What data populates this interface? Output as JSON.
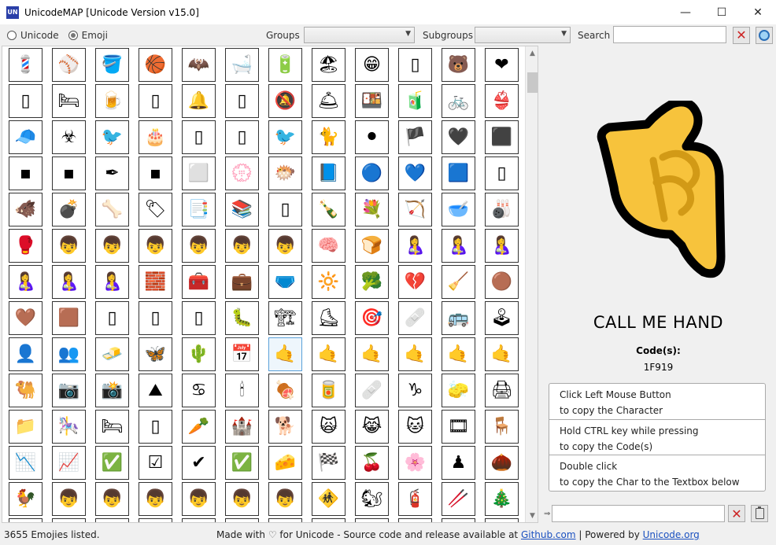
{
  "window": {
    "title": "UnicodeMAP [Unicode Version v15.0]",
    "app_icon": "UN",
    "minimize": "—",
    "maximize": "☐",
    "close": "✕"
  },
  "toolbar": {
    "unicode_label": "Unicode",
    "emoji_label": "Emoji",
    "mode_selected": "Emoji",
    "groups_label": "Groups",
    "groups_value": "",
    "subgroups_label": "Subgroups",
    "subgroups_value": "",
    "search_label": "Search",
    "search_value": "",
    "clear_glyph": "✕"
  },
  "emoji_rows": [
    [
      "💈",
      "⚾",
      "🪣",
      "🏀",
      "🦇",
      "🛁",
      "🔋",
      "🏖",
      "😁",
      "▯",
      "🐻",
      "❤"
    ],
    [
      "▯",
      "🛏",
      "🍺",
      "▯",
      "🔔",
      "▯",
      "🔕",
      "🛎",
      "🍱",
      "🧃",
      "🚲",
      "👙"
    ],
    [
      "🧢",
      "☣",
      "🐦",
      "🎂",
      "▯",
      "▯",
      "🐦",
      "🐈",
      "⚫",
      "🏴",
      "🖤",
      "⬛"
    ],
    [
      "▪",
      "▪",
      "✒",
      "▪",
      "⬜",
      "💮",
      "🐡",
      "📘",
      "🔵",
      "💙",
      "🟦",
      "▯"
    ],
    [
      "🐗",
      "💣",
      "🦴",
      "🏷",
      "📑",
      "📚",
      "▯",
      "🍾",
      "💐",
      "🏹",
      "🥣",
      "🎳"
    ],
    [
      "🥊",
      "👦",
      "👦",
      "👦",
      "👦",
      "👦",
      "👦",
      "🧠",
      "🍞",
      "🤱",
      "🤱",
      "🤱"
    ],
    [
      "🤱",
      "🤱",
      "🤱",
      "🧱",
      "🧰",
      "💼",
      "🩲",
      "🔆",
      "🥦",
      "💔",
      "🧹",
      "🟤"
    ],
    [
      "🤎",
      "🟫",
      "▯",
      "▯",
      "▯",
      "🐛",
      "🏗",
      "⛸",
      "🎯",
      "🩹",
      "🚌",
      "🕹"
    ],
    [
      "👤",
      "👥",
      "🧈",
      "🦋",
      "🌵",
      "📅",
      "🤙",
      "🤙",
      "🤙",
      "🤙",
      "🤙",
      "🤙"
    ],
    [
      "🐫",
      "📷",
      "📸",
      "⛰",
      "♋",
      "🕯",
      "🍖",
      "🥫",
      "🩹",
      "♑",
      "🧽",
      "🖨"
    ],
    [
      "📁",
      "🎠",
      "🛏",
      "▯",
      "🥕",
      "🏰",
      "🐕",
      "🙀",
      "😹",
      "🐱",
      "🎞",
      "🪑"
    ],
    [
      "📉",
      "📈",
      "✅",
      "☑",
      "✔",
      "✅",
      "🧀",
      "🏁",
      "🍒",
      "🌸",
      "♟",
      "🌰"
    ],
    [
      "🐓",
      "👦",
      "👦",
      "👦",
      "👦",
      "👦",
      "👦",
      "🚸",
      "🐿",
      "🧯",
      "🥢",
      "🎄"
    ],
    [
      "▯",
      "▯",
      "▯",
      "▯",
      "▯",
      "▯",
      "▯",
      "▯",
      "▯",
      "▯",
      "▯",
      "▯"
    ]
  ],
  "selected_cell": {
    "row": 8,
    "col": 6
  },
  "detail": {
    "emoji": "🤙",
    "name": "CALL ME HAND",
    "codes_label": "Code(s):",
    "codes_value": "1F919",
    "emoji_colors": {
      "fill": "#f7c33c",
      "outline": "#000000",
      "shade": "#d29a16"
    }
  },
  "help": [
    {
      "line1": "Click Left Mouse Button",
      "line2": "to copy the Character"
    },
    {
      "line1": "Hold CTRL key while pressing",
      "line2": "to copy the Code(s)"
    },
    {
      "line1": "Double click",
      "line2": "to copy the Char to the Textbox below"
    }
  ],
  "copy_box": {
    "value": "",
    "arrow": "⇒",
    "clear_glyph": "✕"
  },
  "status": {
    "count": "3655 Emojies listed.",
    "made_with": "Made with",
    "heart": "♡",
    "for_unicode": "for Unicode - Source code and release available at",
    "github": "Github.com",
    "separator": "| Powered by",
    "unicode_org": "Unicode.org"
  }
}
